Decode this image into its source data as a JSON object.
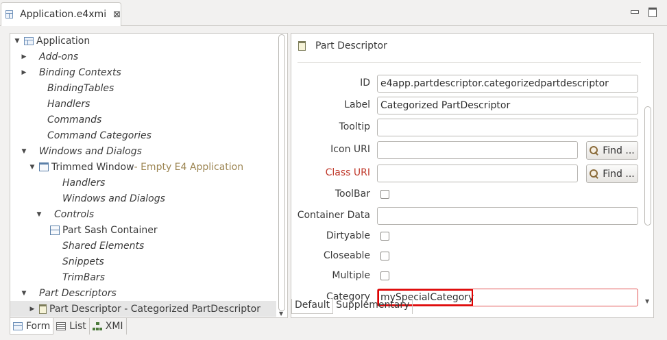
{
  "editor_tab": {
    "title": "Application.e4xmi",
    "close_glyph": "⊠",
    "icon": "e4xmi-file-icon"
  },
  "window_controls": {
    "minimize_icon": "minimize-icon",
    "maximize_icon": "maximize-icon"
  },
  "tree": {
    "items": [
      {
        "label": "Application",
        "decoration": "",
        "expand": "open",
        "italic": false,
        "icon": "application-icon"
      },
      {
        "label": "Add-ons",
        "decoration": "",
        "expand": "closed",
        "italic": true,
        "icon": ""
      },
      {
        "label": "Binding Contexts",
        "decoration": "",
        "expand": "closed",
        "italic": true,
        "icon": ""
      },
      {
        "label": "BindingTables",
        "decoration": "",
        "expand": "none",
        "italic": true,
        "icon": ""
      },
      {
        "label": "Handlers",
        "decoration": "",
        "expand": "none",
        "italic": true,
        "icon": ""
      },
      {
        "label": "Commands",
        "decoration": "",
        "expand": "none",
        "italic": true,
        "icon": ""
      },
      {
        "label": "Command Categories",
        "decoration": "",
        "expand": "none",
        "italic": true,
        "icon": ""
      },
      {
        "label": "Windows and Dialogs",
        "decoration": "",
        "expand": "open",
        "italic": true,
        "icon": ""
      },
      {
        "label": "Trimmed Window",
        "decoration": " - Empty E4 Application",
        "expand": "open",
        "italic": false,
        "icon": "trimmed-window-icon"
      },
      {
        "label": "Handlers",
        "decoration": "",
        "expand": "none",
        "italic": true,
        "icon": ""
      },
      {
        "label": "Windows and Dialogs",
        "decoration": "",
        "expand": "none",
        "italic": true,
        "icon": ""
      },
      {
        "label": "Controls",
        "decoration": "",
        "expand": "open",
        "italic": true,
        "icon": ""
      },
      {
        "label": "Part Sash Container",
        "decoration": "",
        "expand": "none",
        "italic": false,
        "icon": "part-sash-container-icon"
      },
      {
        "label": "Shared Elements",
        "decoration": "",
        "expand": "none",
        "italic": true,
        "icon": ""
      },
      {
        "label": "Snippets",
        "decoration": "",
        "expand": "none",
        "italic": true,
        "icon": ""
      },
      {
        "label": "TrimBars",
        "decoration": "",
        "expand": "none",
        "italic": true,
        "icon": ""
      },
      {
        "label": "Part Descriptors",
        "decoration": "",
        "expand": "open",
        "italic": true,
        "icon": ""
      },
      {
        "label": "Part Descriptor - Categorized PartDescriptor",
        "decoration": "",
        "expand": "closed",
        "italic": false,
        "icon": "part-descriptor-icon",
        "selected": true
      }
    ]
  },
  "detail": {
    "title": "Part Descriptor",
    "fields": {
      "id": {
        "label": "ID",
        "value": "e4app.partdescriptor.categorizedpartdescriptor"
      },
      "label": {
        "label": "Label",
        "value": "Categorized PartDescriptor"
      },
      "tooltip": {
        "label": "Tooltip",
        "value": ""
      },
      "icon_uri": {
        "label": "Icon URI",
        "value": ""
      },
      "class_uri": {
        "label": "Class URI",
        "value": ""
      },
      "toolbar": {
        "label": "ToolBar",
        "checked": false
      },
      "container_data": {
        "label": "Container Data",
        "value": ""
      },
      "dirtyable": {
        "label": "Dirtyable",
        "checked": false
      },
      "closeable": {
        "label": "Closeable",
        "checked": false
      },
      "multiple": {
        "label": "Multiple",
        "checked": false
      },
      "category": {
        "label": "Category",
        "value": "mySpecialCategory"
      }
    },
    "find_label": "Find ...",
    "sub_tabs": [
      "Default",
      "Supplementary"
    ]
  },
  "bottom_tabs": [
    {
      "label": "Form",
      "icon": "form-icon"
    },
    {
      "label": "List",
      "icon": "list-icon"
    },
    {
      "label": "XMI",
      "icon": "xmi-tree-icon"
    }
  ],
  "colors": {
    "error_label": "#c0392b",
    "annotation_box": "#e00000",
    "decoration_text": "#9c8552"
  }
}
